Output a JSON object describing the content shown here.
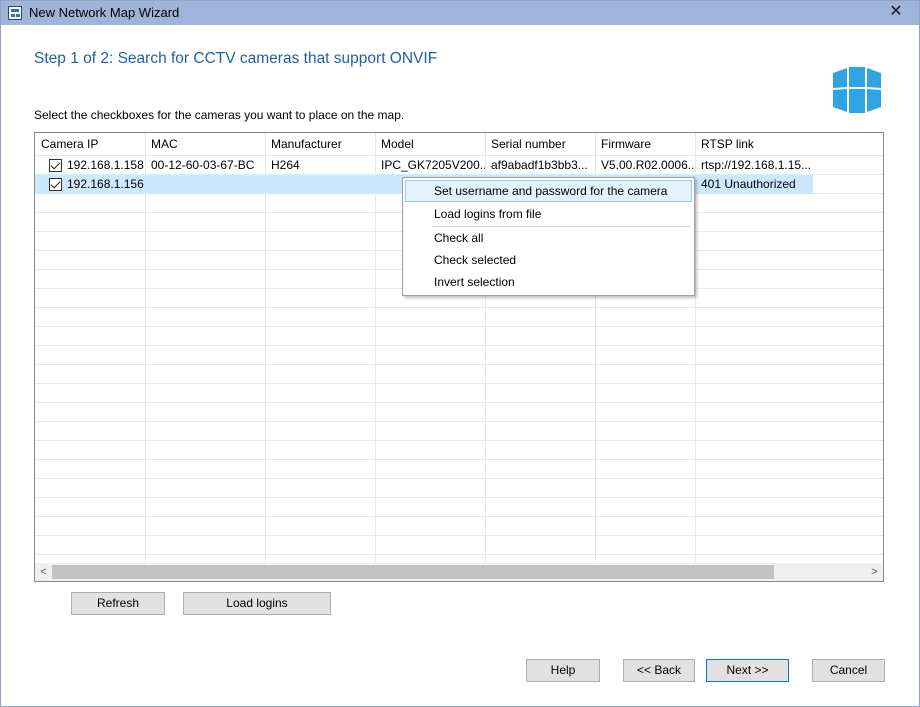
{
  "window": {
    "title": "New Network Map Wizard",
    "close_glyph": "✕"
  },
  "step_title": "Step 1 of 2: Search for CCTV cameras that support ONVIF",
  "instruction": "Select the checkboxes for the cameras you want to place on the map.",
  "table": {
    "columns": [
      "Camera IP",
      "MAC",
      "Manufacturer",
      "Model",
      "Serial number",
      "Firmware",
      "RTSP link"
    ],
    "rows": [
      {
        "checked": true,
        "cells": [
          "192.168.1.158",
          "00-12-60-03-67-BC",
          "H264",
          "IPC_GK7205V200...",
          "af9abadf1b3bb3...",
          "V5.00.R02.0006...",
          "rtsp://192.168.1.15..."
        ]
      },
      {
        "checked": true,
        "selected": true,
        "cells": [
          "192.168.1.156",
          "",
          "",
          "",
          "",
          "",
          "401 Unauthorized"
        ]
      }
    ]
  },
  "context_menu": {
    "items": [
      "Set username and password for the camera",
      "Load logins from file",
      "Check all",
      "Check selected",
      "Invert selection"
    ],
    "highlighted_index": 0
  },
  "scrollbar": {
    "left_glyph": "<",
    "right_glyph": ">"
  },
  "buttons": {
    "refresh": "Refresh",
    "load_logins": "Load logins",
    "help": "Help",
    "back": "<< Back",
    "next": "Next >>",
    "cancel": "Cancel"
  },
  "colors": {
    "titlebar": "#9fb4d9",
    "heading": "#1f5fa8",
    "logo": "#2fa3e3",
    "selected_row": "#cce8ff",
    "default_button_border": "#0078d7"
  },
  "icons": {
    "app": "network-map-icon",
    "logo": "window-panes-logo-icon",
    "checkbox": "checkbox-checked-icon"
  }
}
